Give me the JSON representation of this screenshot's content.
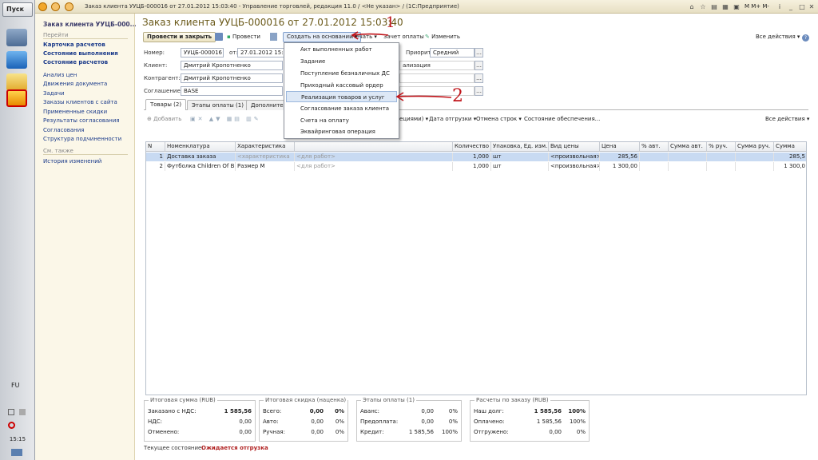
{
  "taskbar": {
    "start_label": "Пуск",
    "lang": "FU",
    "time": "15:15"
  },
  "window": {
    "title": "Заказ клиента УУЦБ-000016 от 27.01.2012 15:03:40 - Управление торговлей, редакция 11.0 / <Не указан> / (1С:Предприятие)",
    "toolbar_right": "M  M+  M-"
  },
  "nav": {
    "doc_link": "Заказ клиента УУЦБ-000...",
    "go_header": "Перейти",
    "bold_links": [
      "Карточка расчетов",
      "Состояние выполнения",
      "Состояние расчетов"
    ],
    "links": [
      "Анализ цен",
      "Движения документа",
      "Задачи",
      "Заказы клиентов с сайта",
      "Примененные скидки",
      "Результаты согласования",
      "Согласования",
      "Структура подчиненности"
    ],
    "see_also_header": "См. также",
    "see_also": [
      "История изменений"
    ]
  },
  "main": {
    "title": "Заказ клиента УУЦБ-000016 от 27.01.2012 15:03:40",
    "toolbar": {
      "post_close": "Провести и закрыть",
      "post": "Провести",
      "create_based": "Создать на основании",
      "print": "Печать",
      "offset": "Зачет оплаты",
      "edit": "Изменить",
      "all_actions": "Все действия"
    },
    "fields": {
      "number_label": "Номер:",
      "number": "УУЦБ-000016",
      "date_label": "от:",
      "date": "27.01.2012 15:03:40",
      "priority_label": "Приоритет:",
      "priority": "Средний",
      "client_label": "Клиент:",
      "client": "Дмитрий Кропотненко",
      "counterparty_label": "Контрагент:",
      "counterparty": "Дмитрий Кропотненко",
      "agreement_label": "Соглашение:",
      "agreement": "BASE",
      "status_partial": "ализация"
    },
    "tabs": [
      "Товары (2)",
      "Этапы оплаты (1)",
      "Дополнител"
    ],
    "grid_toolbar": {
      "add": "Добавить",
      "aqq": "ециями)",
      "ship_date": "Дата отгрузки",
      "cancel_rows": "Отмена строк",
      "state": "Состояние обеспечения...",
      "all_actions": "Все действия"
    },
    "columns": [
      "N",
      "Номенклатура",
      "Характеристика",
      "",
      "Количество",
      "Упаковка, Ед. изм.",
      "Вид цены",
      "Цена",
      "% авт.",
      "Сумма авт.",
      "% руч.",
      "Сумма руч.",
      "Сумма"
    ],
    "rows": [
      {
        "n": "1",
        "item": "Доставка заказа",
        "char": "<характеристика",
        "extra": "<для работ>",
        "qty": "1,000",
        "unit": "шт",
        "price_type": "<произвольная>",
        "price": "285,56",
        "sum": "285,5"
      },
      {
        "n": "2",
        "item": "Футболка Children Of B...",
        "char": "Размер M",
        "extra": "<для работ>",
        "qty": "1,000",
        "unit": "шт",
        "price_type": "<произвольная>",
        "price": "1 300,00",
        "sum": "1 300,0"
      }
    ]
  },
  "menu": {
    "items": [
      "Акт выполненных работ",
      "Задание",
      "Поступление безналичных ДС",
      "Приходный кассовый ордер",
      "Реализация товаров и услуг",
      "Согласование заказа клиента",
      "Счета на оплату",
      "Эквайринговая операция"
    ],
    "selected_index": 4
  },
  "annotations": {
    "one": "1",
    "two": "2"
  },
  "totals": {
    "sum": {
      "title": "Итоговая сумма (RUB)",
      "rows": [
        [
          "Заказано с НДС:",
          "1 585,56"
        ],
        [
          "НДС:",
          "0,00"
        ],
        [
          "Отменено:",
          "0,00"
        ]
      ]
    },
    "discount": {
      "title": "Итоговая скидка (наценка)",
      "rows": [
        [
          "Всего:",
          "0,00",
          "0%"
        ],
        [
          "Авто:",
          "0,00",
          "0%"
        ],
        [
          "Ручная:",
          "0,00",
          "0%"
        ]
      ]
    },
    "stages": {
      "title": "Этапы оплаты (1)",
      "rows": [
        [
          "Аванс:",
          "0,00",
          "0%"
        ],
        [
          "Предоплата:",
          "0,00",
          "0%"
        ],
        [
          "Кредит:",
          "1 585,56",
          "100%"
        ]
      ]
    },
    "settle": {
      "title": "Расчеты по заказу (RUB)",
      "rows": [
        [
          "Наш долг:",
          "1 585,56",
          "100%"
        ],
        [
          "Оплачено:",
          "1 585,56",
          "100%"
        ],
        [
          "Отгружено:",
          "0,00",
          "0%"
        ]
      ]
    }
  },
  "status": {
    "label": "Текущее состояние:",
    "value": "Ожидается отгрузка"
  },
  "colors": {
    "accent": "#6b5a1a",
    "selection": "#dde8f6",
    "status": "#b02020",
    "annotation": "#c0151b"
  }
}
